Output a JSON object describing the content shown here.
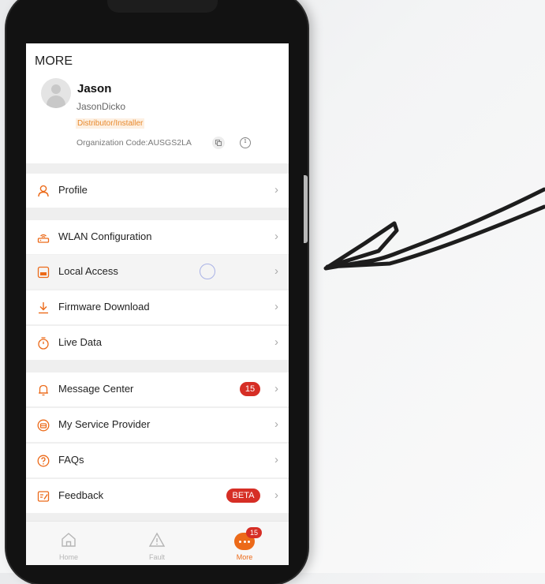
{
  "header": {
    "title": "MORE",
    "user_name": "Jason",
    "user_handle": "JasonDicko",
    "role": "Distributor/Installer",
    "org_code": "Organization Code:AUSGS2LA"
  },
  "menu": {
    "profile": "Profile",
    "wlan": "WLAN Configuration",
    "local_access": "Local Access",
    "firmware": "Firmware Download",
    "live_data": "Live Data",
    "message_center": "Message Center",
    "message_count": "15",
    "service_provider": "My Service Provider",
    "faqs": "FAQs",
    "feedback": "Feedback",
    "feedback_badge": "BETA"
  },
  "tabs": {
    "home": "Home",
    "fault": "Fault",
    "more": "More",
    "more_count": "15"
  },
  "colors": {
    "accent": "#EC6A19",
    "badge_red": "#D62E25",
    "role_text": "#E8892D"
  }
}
